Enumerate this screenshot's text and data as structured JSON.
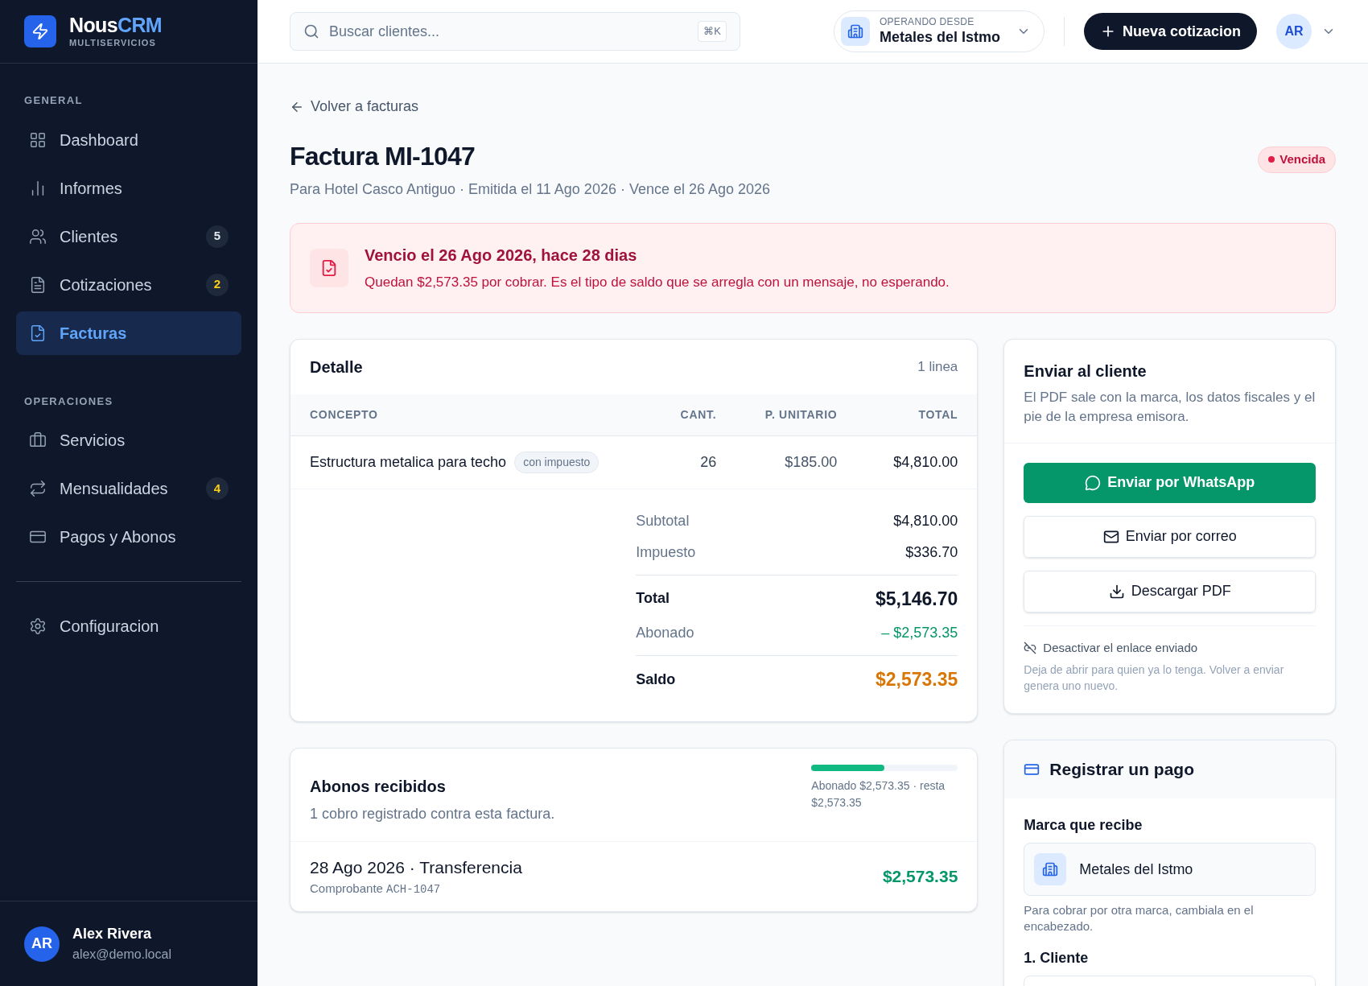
{
  "brand": {
    "name_a": "Nous",
    "name_b": "CRM",
    "subtitle": "MULTISERVICIOS"
  },
  "sidebar": {
    "sections": [
      {
        "title": "GENERAL",
        "items": [
          {
            "label": "Dashboard",
            "selected": false
          },
          {
            "label": "Informes",
            "selected": false
          },
          {
            "label": "Clientes",
            "selected": false,
            "badge": {
              "text": "5",
              "color": "#e2e8f0"
            }
          },
          {
            "label": "Cotizaciones",
            "selected": false,
            "badge": {
              "text": "2",
              "color": "#facc15"
            }
          },
          {
            "label": "Facturas",
            "selected": true
          }
        ]
      },
      {
        "title": "OPERACIONES",
        "items": [
          {
            "label": "Servicios",
            "selected": false
          },
          {
            "label": "Mensualidades",
            "selected": false,
            "badge": {
              "text": "4",
              "color": "#facc15"
            }
          },
          {
            "label": "Pagos y Abonos",
            "selected": false
          }
        ]
      }
    ],
    "footer_items": [
      {
        "label": "Configuracion",
        "selected": false
      }
    ],
    "user": {
      "initials": "AR",
      "name": "Alex Rivera",
      "email": "alex@demo.local"
    }
  },
  "header": {
    "search": {
      "placeholder": "Buscar clientes...",
      "shortcut": "⌘K"
    },
    "operating": {
      "label": "OPERANDO DESDE",
      "value": "Metales del Istmo"
    },
    "new_button": "Nueva cotizacion",
    "avatar": "AR"
  },
  "page": {
    "back": "Volver a facturas",
    "title": "Factura MI-1047",
    "subtitle": "Para Hotel Casco Antiguo · Emitida el 11 Ago 2026 · Vence el 26 Ago 2026",
    "status": "Vencida"
  },
  "alert": {
    "title": "Vencio el 26 Ago 2026, hace 28 dias",
    "text": "Quedan $2,573.35 por cobrar. Es el tipo de saldo que se arregla con un mensaje, no esperando."
  },
  "detail": {
    "title": "Detalle",
    "count": "1 linea",
    "columns": [
      "CONCEPTO",
      "CANT.",
      "P. UNITARIO",
      "TOTAL"
    ],
    "rows": [
      {
        "concept": "Estructura metalica para techo",
        "tag": "con impuesto",
        "qty": "26",
        "unit": "$185.00",
        "total": "$4,810.00"
      }
    ],
    "totals": [
      {
        "kind": "plain",
        "label": "Subtotal",
        "value": "$4,810.00"
      },
      {
        "kind": "plain",
        "label": "Impuesto",
        "value": "$336.70"
      },
      {
        "kind": "total",
        "label": "Total",
        "value": "$5,146.70"
      },
      {
        "kind": "paid",
        "label": "Abonado",
        "value": "– $2,573.35"
      },
      {
        "kind": "balance",
        "label": "Saldo",
        "value": "$2,573.35"
      }
    ]
  },
  "payments": {
    "title": "Abonos recibidos",
    "subtitle": "1 cobro registrado contra esta factura.",
    "level": 0.5,
    "progress_text": "Abonado $2,573.35 · resta $2,573.35",
    "items": [
      {
        "title": "28 Ago 2026 · Transferencia",
        "receipt_label": "Comprobante",
        "receipt": "ACH-1047",
        "amount": "$2,573.35"
      }
    ]
  },
  "send": {
    "title": "Enviar al cliente",
    "text": "El PDF sale con la marca, los datos fiscales y el pie de la empresa emisora.",
    "whatsapp": "Enviar por WhatsApp",
    "email": "Enviar por correo",
    "pdf": "Descargar PDF",
    "disable_link": "Desactivar el enlace enviado",
    "disable_text": "Deja de abrir para quien ya lo tenga. Volver a enviar genera uno nuevo."
  },
  "register": {
    "title": "Registrar un pago",
    "brand_label": "Marca que recibe",
    "brand": "Metales del Istmo",
    "brand_hint": "Para cobrar por otra marca, cambiala en el encabezado.",
    "client_label": "1. Cliente"
  }
}
